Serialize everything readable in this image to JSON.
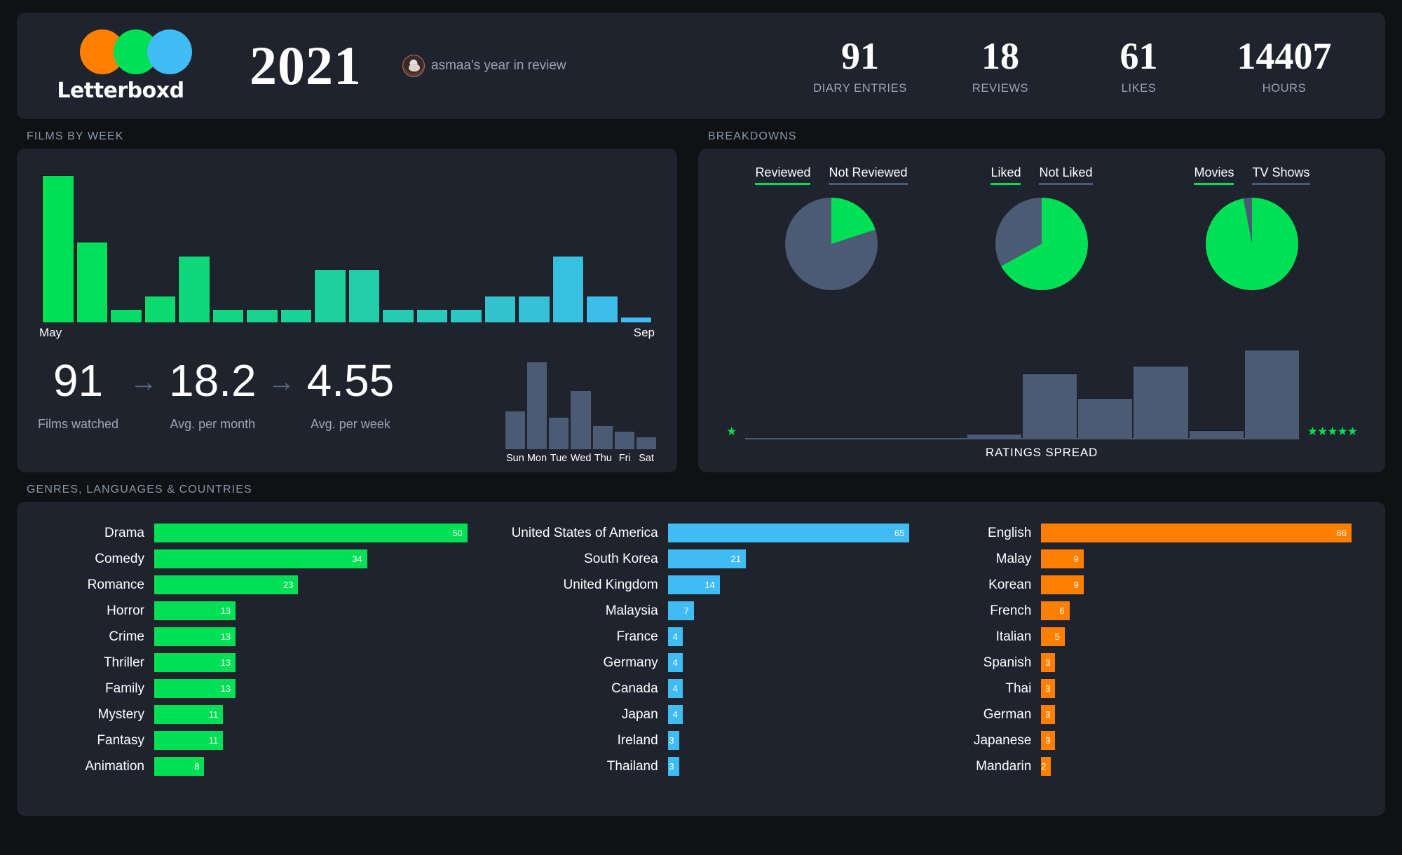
{
  "header": {
    "logo_word": "Letterboxd",
    "year": "2021",
    "user_line": "asmaa's year in review",
    "stats": [
      {
        "value": "91",
        "label": "DIARY ENTRIES"
      },
      {
        "value": "18",
        "label": "REVIEWS"
      },
      {
        "value": "61",
        "label": "LIKES"
      },
      {
        "value": "14407",
        "label": "HOURS"
      }
    ]
  },
  "sections": {
    "films_by_week": "FILMS BY WEEK",
    "breakdowns": "BREAKDOWNS",
    "genres_languages_countries": "GENRES, LANGUAGES & COUNTRIES"
  },
  "films": {
    "axis_start": "May",
    "axis_end": "Sep",
    "summary": [
      {
        "value": "91",
        "label": "Films watched"
      },
      {
        "value": "18.2",
        "label": "Avg. per month"
      },
      {
        "value": "4.55",
        "label": "Avg. per week"
      }
    ],
    "arrow": "→",
    "day_labels": [
      "Sun",
      "Mon",
      "Tue",
      "Wed",
      "Thu",
      "Fri",
      "Sat"
    ]
  },
  "breakdowns": {
    "pies": [
      {
        "on_label": "Reviewed",
        "off_label": "Not Reviewed",
        "on_pct": 20
      },
      {
        "on_label": "Liked",
        "off_label": "Not Liked",
        "on_pct": 67
      },
      {
        "on_label": "Movies",
        "off_label": "TV Shows",
        "on_pct": 97
      }
    ],
    "ratings_label": "RATINGS SPREAD",
    "star_low": "★",
    "star_high": "★★★★★"
  },
  "colors": {
    "orange": "#FF8000",
    "green": "#00E054",
    "blue": "#40BCF4",
    "slate": "#4b5b73",
    "card": "#1f232d",
    "header_card": "#20242e",
    "page_bg": "#0f1114"
  },
  "chart_data": [
    {
      "type": "bar",
      "title": "FILMS BY WEEK",
      "xlabel": "",
      "ylabel": "Films",
      "categories": [
        "w1",
        "w2",
        "w3",
        "w4",
        "w5",
        "w6",
        "w7",
        "w8",
        "w9",
        "w10",
        "w11",
        "w12",
        "w13",
        "w14",
        "w15",
        "w16",
        "w17",
        "w18"
      ],
      "tick_labels": [
        "May",
        "Sep"
      ],
      "values": [
        11,
        6,
        1,
        2,
        5,
        1,
        1,
        1,
        4,
        4,
        1,
        1,
        1,
        2,
        2,
        5,
        2,
        0
      ],
      "ylim": [
        0,
        11
      ],
      "grid": false,
      "note": "Bars colored on a green-to-blue gradient across the weeks"
    },
    {
      "type": "bar",
      "title": "Films by day of week",
      "categories": [
        "Sun",
        "Mon",
        "Tue",
        "Wed",
        "Thu",
        "Fri",
        "Sat"
      ],
      "values": [
        13,
        30,
        11,
        20,
        8,
        6,
        4
      ],
      "ylim": [
        0,
        30
      ],
      "grid": false
    },
    {
      "type": "pie",
      "title": "Reviewed",
      "labels": [
        "Reviewed",
        "Not Reviewed"
      ],
      "values": [
        20,
        80
      ],
      "legend": "top"
    },
    {
      "type": "pie",
      "title": "Liked",
      "labels": [
        "Liked",
        "Not Liked"
      ],
      "values": [
        67,
        33
      ],
      "legend": "top"
    },
    {
      "type": "pie",
      "title": "Movies",
      "labels": [
        "Movies",
        "TV Shows"
      ],
      "values": [
        97,
        3
      ],
      "legend": "top"
    },
    {
      "type": "bar",
      "title": "RATINGS SPREAD",
      "categories": [
        "0.5",
        "1",
        "1.5",
        "2",
        "2.5",
        "3",
        "3.5",
        "4",
        "4.5",
        "5"
      ],
      "values": [
        0,
        0,
        0,
        0,
        1,
        16,
        10,
        18,
        2,
        22
      ],
      "ylim": [
        0,
        22
      ],
      "grid": false
    },
    {
      "type": "bar",
      "title": "Genres",
      "orientation": "horizontal",
      "categories": [
        "Drama",
        "Comedy",
        "Romance",
        "Horror",
        "Crime",
        "Thriller",
        "Family",
        "Mystery",
        "Fantasy",
        "Animation"
      ],
      "values": [
        50,
        34,
        23,
        13,
        13,
        13,
        13,
        11,
        11,
        8
      ],
      "xlim": [
        0,
        50
      ]
    },
    {
      "type": "bar",
      "title": "Countries",
      "orientation": "horizontal",
      "categories": [
        "United States of America",
        "South Korea",
        "United Kingdom",
        "Malaysia",
        "France",
        "Germany",
        "Canada",
        "Japan",
        "Ireland",
        "Thailand"
      ],
      "values": [
        65,
        21,
        14,
        7,
        4,
        4,
        4,
        4,
        3,
        3
      ],
      "xlim": [
        0,
        65
      ]
    },
    {
      "type": "bar",
      "title": "Languages",
      "orientation": "horizontal",
      "categories": [
        "English",
        "Malay",
        "Korean",
        "French",
        "Italian",
        "Spanish",
        "Thai",
        "German",
        "Japanese",
        "Mandarin"
      ],
      "values": [
        66,
        9,
        9,
        6,
        5,
        3,
        3,
        3,
        3,
        2
      ],
      "xlim": [
        0,
        66
      ]
    }
  ]
}
